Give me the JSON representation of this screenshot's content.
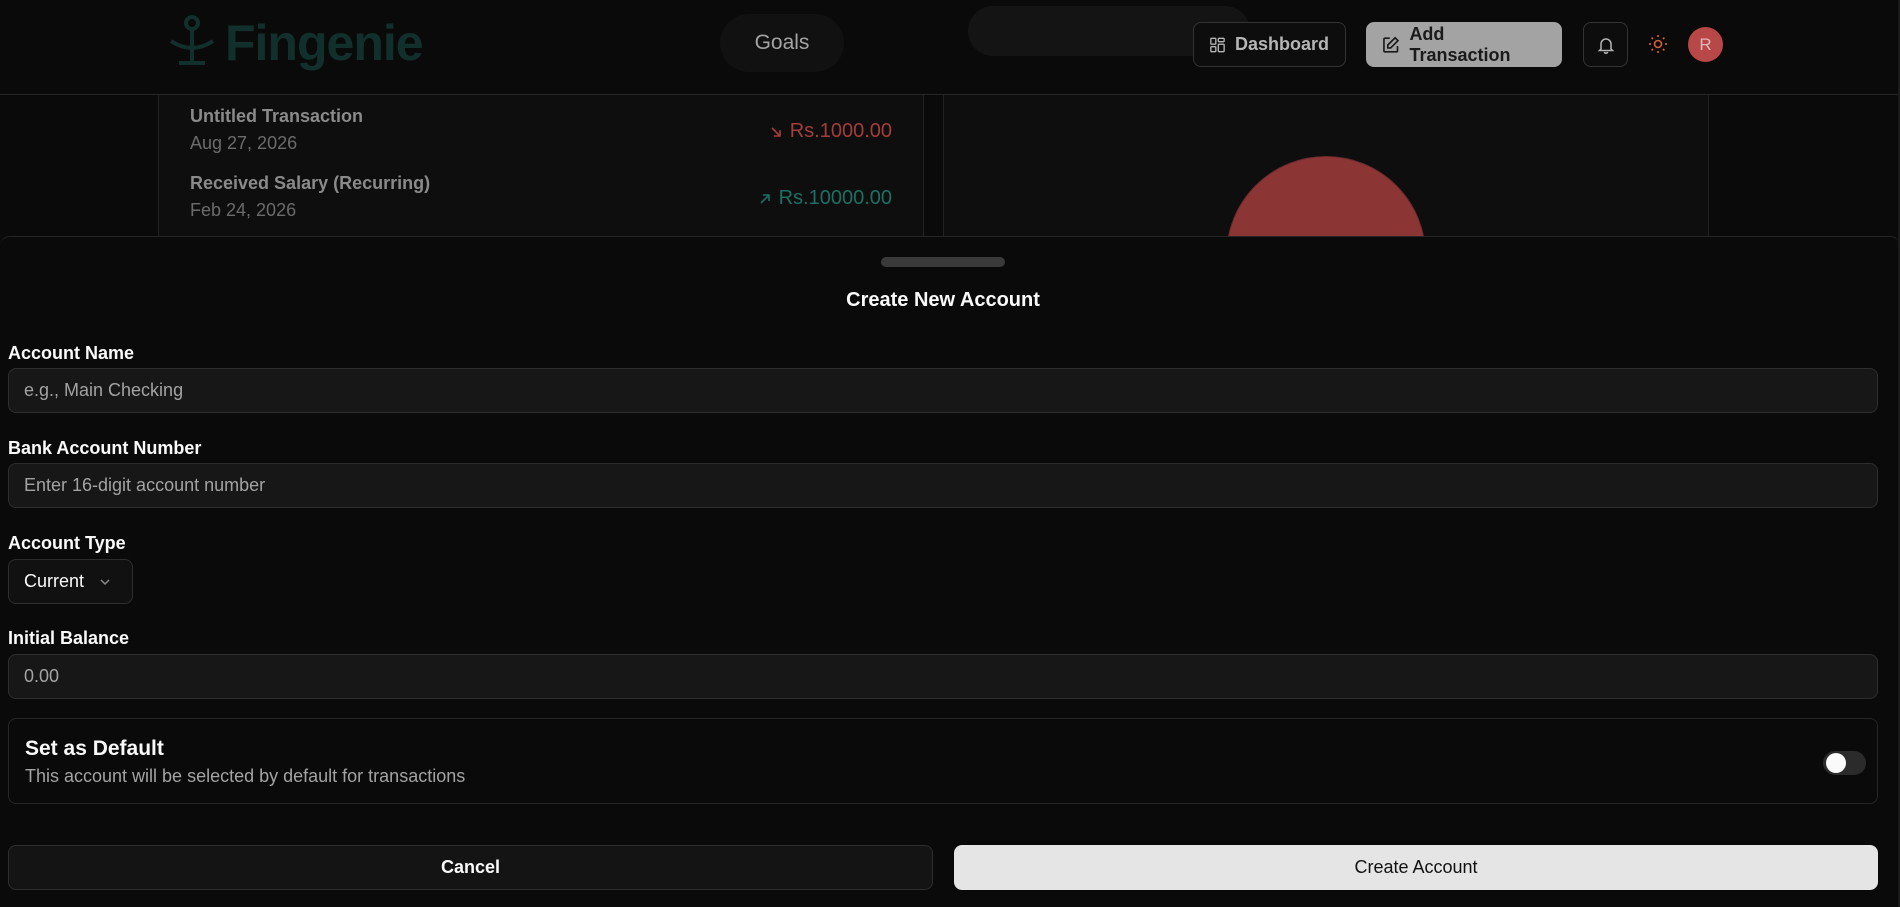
{
  "header": {
    "logo_text": "Fingenie",
    "nav_goals": "Goals",
    "dashboard_label": "Dashboard",
    "add_transaction_label": "Add Transaction",
    "avatar_initial": "R"
  },
  "transactions": [
    {
      "name": "Untitled Transaction",
      "date": "Aug 27, 2026",
      "amount": "Rs.1000.00",
      "direction": "out"
    },
    {
      "name": "Received Salary (Recurring)",
      "date": "Feb 24, 2026",
      "amount": "Rs.10000.00",
      "direction": "in"
    }
  ],
  "drawer": {
    "title": "Create New Account",
    "account_name": {
      "label": "Account Name",
      "placeholder": "e.g., Main Checking"
    },
    "bank_account_number": {
      "label": "Bank Account Number",
      "placeholder": "Enter 16-digit account number"
    },
    "account_type": {
      "label": "Account Type",
      "value": "Current"
    },
    "initial_balance": {
      "label": "Initial Balance",
      "placeholder": "0.00"
    },
    "default": {
      "title": "Set as Default",
      "description": "This account will be selected by default for transactions",
      "enabled": false
    },
    "cancel_label": "Cancel",
    "create_label": "Create Account"
  },
  "colors": {
    "accent_teal": "#1b5e53",
    "expense_red": "#a33c3c",
    "income_teal": "#1e6f62",
    "avatar_red": "#b84747",
    "chart_slice": "#8b3535"
  }
}
